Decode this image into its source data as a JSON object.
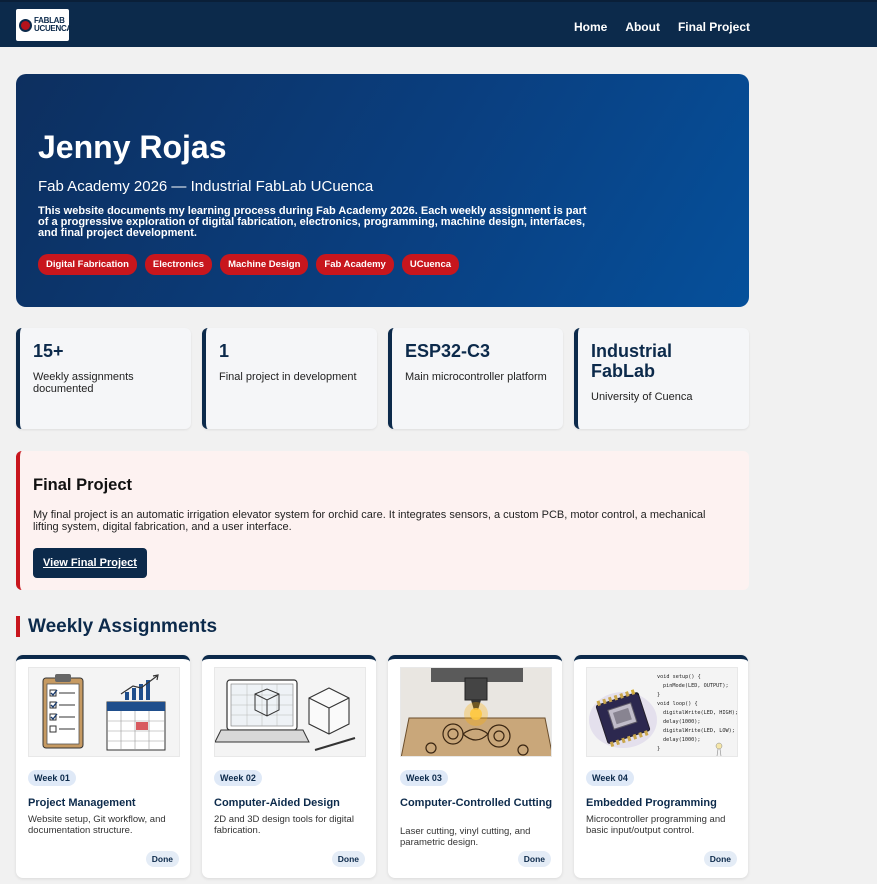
{
  "nav": {
    "logo_line1": "FABLAB",
    "logo_line2": "UCUENCA",
    "links": [
      "Home",
      "About",
      "Final Project"
    ]
  },
  "hero": {
    "name": "Jenny Rojas",
    "subtitle": "Fab Academy 2026 — Industrial FabLab UCuenca",
    "description": "This website documents my learning process during Fab Academy 2026. Each weekly assignment is part of a progressive exploration of digital fabrication, electronics, programming, machine design, interfaces, and final project development.",
    "tags": [
      "Digital Fabrication",
      "Electronics",
      "Machine Design",
      "Fab Academy",
      "UCuenca"
    ]
  },
  "stats": [
    {
      "value": "15+",
      "label": "Weekly assignments documented"
    },
    {
      "value": "1",
      "label": "Final project in development"
    },
    {
      "value": "ESP32-C3",
      "label": "Main microcontroller platform"
    },
    {
      "value": "Industrial FabLab",
      "label": "University of Cuenca"
    }
  ],
  "final_project": {
    "title": "Final Project",
    "text": "My final project is an automatic irrigation elevator system for orchid care. It integrates sensors, a custom PCB, motor control, a mechanical lifting system, digital fabrication, and a user interface.",
    "button": "View Final Project"
  },
  "weekly": {
    "title": "Weekly Assignments",
    "cards": [
      {
        "week": "Week 01",
        "title": "Project Management",
        "desc": "Website setup, Git workflow, and documentation structure.",
        "status": "Done",
        "icon": "clipboard-calendar-illustration"
      },
      {
        "week": "Week 02",
        "title": "Computer-Aided Design",
        "desc": "2D and 3D design tools for digital fabrication.",
        "status": "Done",
        "icon": "laptop-cad-illustration"
      },
      {
        "week": "Week 03",
        "title": "Computer-Controlled Cutting",
        "desc": "Laser cutting, vinyl cutting, and parametric design.",
        "status": "Done",
        "icon": "laser-cutter-illustration"
      },
      {
        "week": "Week 04",
        "title": "Embedded Programming",
        "desc": "Microcontroller programming and basic input/output control.",
        "status": "Done",
        "icon": "microcontroller-code-illustration"
      }
    ]
  },
  "code_snippet": [
    "void setup() {",
    "pinMode(LED, OUTPUT);",
    "}",
    "void loop() {",
    "digitalWrite(LED, HIGH);",
    "delay(1000);",
    "digitalWrite(LED, LOW);",
    "delay(1000);",
    "}"
  ]
}
